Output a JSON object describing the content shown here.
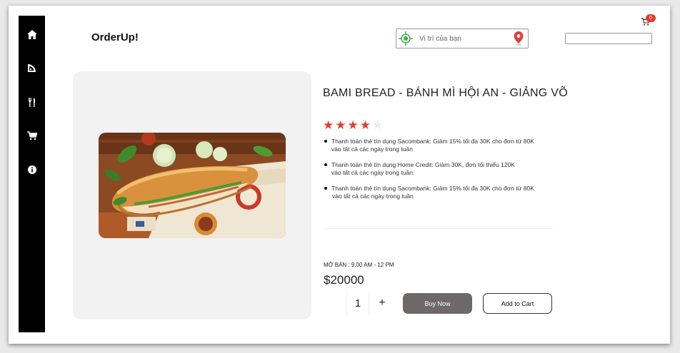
{
  "app": {
    "logo": "OrderUp!"
  },
  "header": {
    "location_placeholder": "Vị trí của bạn",
    "search_placeholder": "",
    "cart_count": "0"
  },
  "sidebar": {
    "icons": [
      "home-icon",
      "pizza-icon",
      "utensils-icon",
      "cart-icon",
      "info-icon"
    ]
  },
  "product": {
    "title": "BAMI BREAD - BÁNH MÌ HỘI AN - GIẢNG VÕ",
    "rating": 4,
    "rating_max": 5,
    "promotions": [
      {
        "line1": "Thanh toán thẻ tín dụng Sacombank: Giảm 15% tối đa 30K cho đơn từ 80K",
        "line2": "vào tất cả các ngày trong tuần"
      },
      {
        "line1": "Thanh toán thẻ tín dụng Home Credit: Giảm 30K, đơn tối thiểu 120K",
        "line2": "vào tất cả các ngày trong tuần."
      },
      {
        "line1": "Thanh toán thẻ tín dụng Sacombank: Giảm 15% tối đa 30K cho đơn từ 80K",
        "line2": "vào tất cả các ngày trong tuần"
      }
    ],
    "hours": "MỞ BÁN : 9.00 AM - 12 PM",
    "price": "$20000",
    "quantity": "1",
    "qty_plus": "+"
  },
  "actions": {
    "buy_now": "Buy Now",
    "add_to_cart": "Add to Cart"
  },
  "colors": {
    "accent": "#e53d2a",
    "sidebar": "#000000",
    "buy_button": "#6f6868",
    "panel": "#f2f2f2"
  }
}
